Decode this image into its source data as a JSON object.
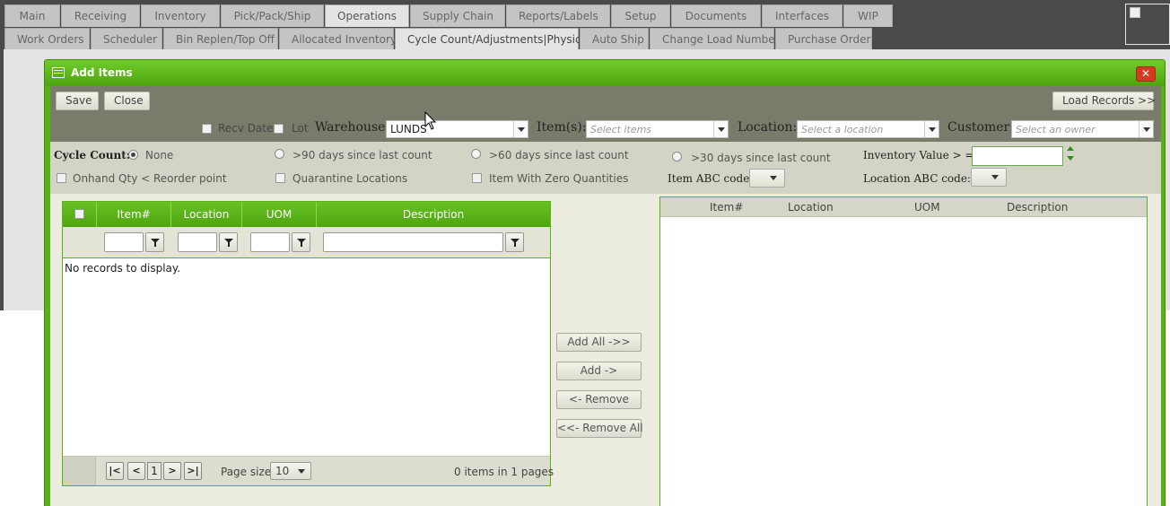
{
  "nav": {
    "row1": [
      "Main",
      "Receiving",
      "Inventory",
      "Pick/Pack/Ship",
      "Operations",
      "Supply Chain",
      "Reports/Labels",
      "Setup",
      "Documents",
      "Interfaces",
      "WIP"
    ],
    "row2": [
      "Work Orders",
      "Scheduler",
      "Bin Replen/Top Off",
      "Allocated Inventory",
      "Cycle Count/Adjustments|Physical",
      "Auto Ship",
      "Change Load Number",
      "Purchase Order"
    ],
    "active_row1": "Operations",
    "active_row2": "Cycle Count/Adjustments|Physical"
  },
  "dialog": {
    "title": "Add Items",
    "close_glyph": "✕",
    "accent_color": "#57b214"
  },
  "toolbar": {
    "save_label": "Save",
    "close_label": "Close",
    "load_records_label": "Load Records >>",
    "recv_date_label": "Recv Date",
    "lot_label": "Lot",
    "warehouse_label": "Warehouse:",
    "warehouse_value": "LUNDS",
    "items_label": "Item(s):",
    "items_placeholder": "Select items",
    "location_label": "Location:",
    "location_placeholder": "Select a location",
    "customer_label": "Customer:",
    "customer_placeholder": "Select an owner"
  },
  "filters": {
    "cycle_count_label": "Cycle Count:",
    "none_label": "None",
    "opt90_label": ">90 days since last count",
    "opt60_label": ">60 days since last count",
    "opt30_label": ">30 days since last count",
    "inventory_value_label": "Inventory Value > = $",
    "inventory_value": "",
    "onhand_label": "Onhand Qty < Reorder point",
    "quarantine_label": "Quarantine Locations",
    "zero_qty_label": "Item With Zero Quantities",
    "item_abc_label": "Item ABC code:",
    "location_abc_label": "Location ABC code:",
    "selected_option": "None"
  },
  "left_grid": {
    "columns": [
      "Item#",
      "Location",
      "UOM",
      "Description"
    ],
    "empty_text": "No records to display.",
    "page": "1",
    "page_size_label": "Page size:",
    "page_size": "10",
    "summary": "0 items in 1 pages"
  },
  "transfer": {
    "add_all": "Add All ->>",
    "add": "Add ->",
    "remove": "<- Remove",
    "remove_all": "<<- Remove All"
  },
  "right_grid": {
    "columns": [
      "Item#",
      "Location",
      "UOM",
      "Description"
    ]
  }
}
